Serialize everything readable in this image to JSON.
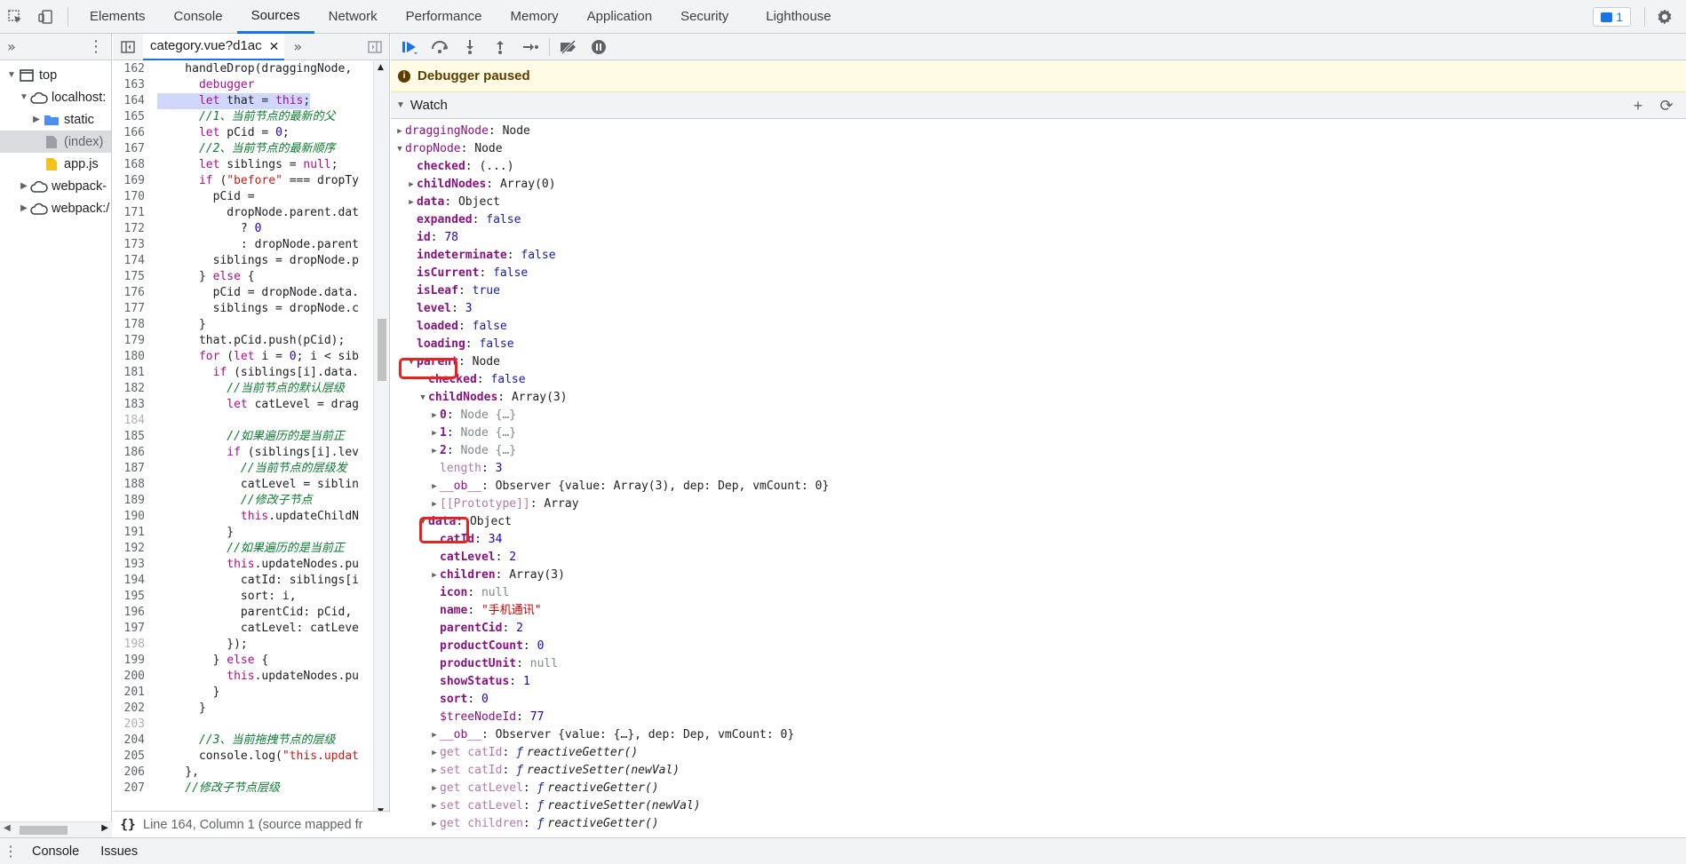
{
  "tabs": [
    "Elements",
    "Console",
    "Sources",
    "Network",
    "Performance",
    "Memory",
    "Application",
    "Security",
    "Lighthouse"
  ],
  "active_tab": "Sources",
  "message_count": "1",
  "navigator": {
    "items": [
      {
        "label": "top",
        "indent": 0,
        "arrow": "down",
        "icon": "frame"
      },
      {
        "label": "localhost:",
        "indent": 1,
        "arrow": "down",
        "icon": "cloud"
      },
      {
        "label": "static",
        "indent": 2,
        "arrow": "right",
        "icon": "folder"
      },
      {
        "label": "(index)",
        "indent": 2,
        "arrow": "",
        "icon": "file-gray",
        "selected": true
      },
      {
        "label": "app.js",
        "indent": 2,
        "arrow": "",
        "icon": "file-yellow"
      },
      {
        "label": "webpack-",
        "indent": 1,
        "arrow": "right",
        "icon": "cloud"
      },
      {
        "label": "webpack:/",
        "indent": 1,
        "arrow": "right",
        "icon": "cloud"
      }
    ]
  },
  "editor": {
    "file_tab": "category.vue?d1ac",
    "status": "Line 164, Column 1  (source mapped fr",
    "lines": [
      {
        "n": "162",
        "parts": [
          [
            "",
            "    handleDrop(draggingNode, "
          ]
        ]
      },
      {
        "n": "163",
        "parts": [
          [
            "kw",
            "      debugger"
          ]
        ]
      },
      {
        "n": "164",
        "hl": true,
        "parts": [
          [
            "kw",
            "      let "
          ],
          [
            "",
            "that = "
          ],
          [
            "kw",
            "this"
          ],
          [
            "",
            ";"
          ]
        ]
      },
      {
        "n": "165",
        "parts": [
          [
            "cm",
            "      //1、当前节点的最新的父"
          ]
        ]
      },
      {
        "n": "166",
        "parts": [
          [
            "kw",
            "      let "
          ],
          [
            "",
            "pCid = "
          ],
          [
            "nm",
            "0"
          ],
          [
            "",
            ";"
          ]
        ]
      },
      {
        "n": "167",
        "parts": [
          [
            "cm",
            "      //2、当前节点的最新顺序"
          ]
        ]
      },
      {
        "n": "168",
        "parts": [
          [
            "kw",
            "      let "
          ],
          [
            "",
            "siblings = "
          ],
          [
            "kw",
            "null"
          ],
          [
            "",
            ";"
          ]
        ]
      },
      {
        "n": "169",
        "parts": [
          [
            "kw",
            "      if "
          ],
          [
            "",
            "("
          ],
          [
            "st",
            "\"before\""
          ],
          [
            "",
            " === dropTy"
          ]
        ]
      },
      {
        "n": "170",
        "parts": [
          [
            "",
            "        pCid ="
          ]
        ]
      },
      {
        "n": "171",
        "parts": [
          [
            "",
            "          dropNode.parent.dat"
          ]
        ]
      },
      {
        "n": "172",
        "parts": [
          [
            "",
            "            ? "
          ],
          [
            "nm",
            "0"
          ]
        ]
      },
      {
        "n": "173",
        "parts": [
          [
            "",
            "            : dropNode.parent"
          ]
        ]
      },
      {
        "n": "174",
        "parts": [
          [
            "",
            "        siblings = dropNode.p"
          ]
        ]
      },
      {
        "n": "175",
        "parts": [
          [
            "",
            "      } "
          ],
          [
            "kw",
            "else"
          ],
          [
            "",
            " {"
          ]
        ]
      },
      {
        "n": "176",
        "parts": [
          [
            "",
            "        pCid = dropNode.data."
          ]
        ]
      },
      {
        "n": "177",
        "parts": [
          [
            "",
            "        siblings = dropNode.c"
          ]
        ]
      },
      {
        "n": "178",
        "parts": [
          [
            "",
            "      }"
          ]
        ]
      },
      {
        "n": "179",
        "parts": [
          [
            "",
            "      that.pCid.push(pCid);"
          ]
        ]
      },
      {
        "n": "180",
        "parts": [
          [
            "kw",
            "      for "
          ],
          [
            "",
            "("
          ],
          [
            "kw",
            "let "
          ],
          [
            "",
            "i = "
          ],
          [
            "nm",
            "0"
          ],
          [
            "",
            "; i < sib"
          ]
        ]
      },
      {
        "n": "181",
        "parts": [
          [
            "kw",
            "        if "
          ],
          [
            "",
            "(siblings[i].data."
          ]
        ]
      },
      {
        "n": "182",
        "parts": [
          [
            "cm",
            "          //当前节点的默认层级"
          ]
        ]
      },
      {
        "n": "183",
        "parts": [
          [
            "kw",
            "          let "
          ],
          [
            "",
            "catLevel = drag"
          ]
        ]
      },
      {
        "n": "184",
        "dim": true,
        "parts": [
          [
            "",
            ""
          ]
        ]
      },
      {
        "n": "185",
        "parts": [
          [
            "cm",
            "          //如果遍历的是当前正"
          ]
        ]
      },
      {
        "n": "186",
        "parts": [
          [
            "kw",
            "          if "
          ],
          [
            "",
            "(siblings[i].lev"
          ]
        ]
      },
      {
        "n": "187",
        "parts": [
          [
            "cm",
            "            //当前节点的层级发"
          ]
        ]
      },
      {
        "n": "188",
        "parts": [
          [
            "",
            "            catLevel = siblin"
          ]
        ]
      },
      {
        "n": "189",
        "parts": [
          [
            "cm",
            "            //修改子节点"
          ]
        ]
      },
      {
        "n": "190",
        "parts": [
          [
            "kw",
            "            this"
          ],
          [
            "",
            ".updateChildN"
          ]
        ]
      },
      {
        "n": "191",
        "parts": [
          [
            "",
            "          }"
          ]
        ]
      },
      {
        "n": "192",
        "parts": [
          [
            "cm",
            "          //如果遍历的是当前正"
          ]
        ]
      },
      {
        "n": "193",
        "parts": [
          [
            "kw",
            "          this"
          ],
          [
            "",
            ".updateNodes.pu"
          ]
        ]
      },
      {
        "n": "194",
        "parts": [
          [
            "",
            "            catId: siblings[i"
          ]
        ]
      },
      {
        "n": "195",
        "parts": [
          [
            "",
            "            sort: i,"
          ]
        ]
      },
      {
        "n": "196",
        "parts": [
          [
            "",
            "            parentCid: pCid,"
          ]
        ]
      },
      {
        "n": "197",
        "parts": [
          [
            "",
            "            catLevel: catLeve"
          ]
        ]
      },
      {
        "n": "198",
        "dim": true,
        "parts": [
          [
            "",
            "          });"
          ]
        ]
      },
      {
        "n": "199",
        "parts": [
          [
            "",
            "        } "
          ],
          [
            "kw",
            "else"
          ],
          [
            "",
            " {"
          ]
        ]
      },
      {
        "n": "200",
        "parts": [
          [
            "kw",
            "          this"
          ],
          [
            "",
            ".updateNodes.pu"
          ]
        ]
      },
      {
        "n": "201",
        "parts": [
          [
            "",
            "        }"
          ]
        ]
      },
      {
        "n": "202",
        "parts": [
          [
            "",
            "      }"
          ]
        ]
      },
      {
        "n": "203",
        "dim": true,
        "parts": [
          [
            "",
            ""
          ]
        ]
      },
      {
        "n": "204",
        "parts": [
          [
            "cm",
            "      //3、当前拖拽节点的层级"
          ]
        ]
      },
      {
        "n": "205",
        "parts": [
          [
            "",
            "      console.log("
          ],
          [
            "st",
            "\"this.updat"
          ]
        ]
      },
      {
        "n": "206",
        "parts": [
          [
            "",
            "    },"
          ]
        ]
      },
      {
        "n": "207",
        "parts": [
          [
            "cm",
            "    //修改子节点层级"
          ]
        ]
      }
    ]
  },
  "debugger": {
    "paused_text": "Debugger paused",
    "watch_title": "Watch",
    "rows": [
      {
        "indent": 0,
        "arrow": "right",
        "key": "draggingNode",
        "style": "k",
        "val": "Node",
        "vtype": ""
      },
      {
        "indent": 0,
        "arrow": "down",
        "key": "dropNode",
        "style": "k",
        "val": "Node",
        "vtype": ""
      },
      {
        "indent": 1,
        "arrow": "",
        "key": "checked",
        "style": "kb",
        "val": "(...)",
        "vtype": ""
      },
      {
        "indent": 1,
        "arrow": "right",
        "key": "childNodes",
        "style": "kb",
        "val": "Array(0)",
        "vtype": ""
      },
      {
        "indent": 1,
        "arrow": "right",
        "key": "data",
        "style": "kb",
        "val": "Object",
        "vtype": ""
      },
      {
        "indent": 1,
        "arrow": "",
        "key": "expanded",
        "style": "kb",
        "val": "false",
        "vtype": "kw"
      },
      {
        "indent": 1,
        "arrow": "",
        "key": "id",
        "style": "kb",
        "val": "78",
        "vtype": "num"
      },
      {
        "indent": 1,
        "arrow": "",
        "key": "indeterminate",
        "style": "kb",
        "val": "false",
        "vtype": "kw"
      },
      {
        "indent": 1,
        "arrow": "",
        "key": "isCurrent",
        "style": "kb",
        "val": "false",
        "vtype": "kw"
      },
      {
        "indent": 1,
        "arrow": "",
        "key": "isLeaf",
        "style": "kb",
        "val": "true",
        "vtype": "kw"
      },
      {
        "indent": 1,
        "arrow": "",
        "key": "level",
        "style": "kb",
        "val": "3",
        "vtype": "num"
      },
      {
        "indent": 1,
        "arrow": "",
        "key": "loaded",
        "style": "kb",
        "val": "false",
        "vtype": "kw"
      },
      {
        "indent": 1,
        "arrow": "",
        "key": "loading",
        "style": "kb",
        "val": "false",
        "vtype": "kw"
      },
      {
        "indent": 1,
        "arrow": "down",
        "key": "parent",
        "style": "kb",
        "val": "Node",
        "vtype": ""
      },
      {
        "indent": 2,
        "arrow": "",
        "key": "checked",
        "style": "kb",
        "val": "false",
        "vtype": "kw"
      },
      {
        "indent": 2,
        "arrow": "down",
        "key": "childNodes",
        "style": "kb",
        "val": "Array(3)",
        "vtype": ""
      },
      {
        "indent": 3,
        "arrow": "right",
        "key": "0",
        "style": "kb",
        "val": "Node {…}",
        "vtype": "nul"
      },
      {
        "indent": 3,
        "arrow": "right",
        "key": "1",
        "style": "kb",
        "val": "Node {…}",
        "vtype": "nul"
      },
      {
        "indent": 3,
        "arrow": "right",
        "key": "2",
        "style": "kb",
        "val": "Node {…}",
        "vtype": "nul"
      },
      {
        "indent": 3,
        "arrow": "",
        "key": "length",
        "style": "kd",
        "val": "3",
        "vtype": "num"
      },
      {
        "indent": 3,
        "arrow": "right",
        "key": "__ob__",
        "style": "k",
        "val": "Observer {value: Array(3), dep: Dep, vmCount: 0}",
        "vtype": ""
      },
      {
        "indent": 3,
        "arrow": "right",
        "key": "[[Prototype]]",
        "style": "kd",
        "val": "Array",
        "vtype": ""
      },
      {
        "indent": 2,
        "arrow": "down",
        "key": "data",
        "style": "kb",
        "val": "Object",
        "vtype": ""
      },
      {
        "indent": 3,
        "arrow": "",
        "key": "catId",
        "style": "kb",
        "val": "34",
        "vtype": "num"
      },
      {
        "indent": 3,
        "arrow": "",
        "key": "catLevel",
        "style": "kb",
        "val": "2",
        "vtype": "num"
      },
      {
        "indent": 3,
        "arrow": "right",
        "key": "children",
        "style": "kb",
        "val": "Array(3)",
        "vtype": ""
      },
      {
        "indent": 3,
        "arrow": "",
        "key": "icon",
        "style": "kb",
        "val": "null",
        "vtype": "nul"
      },
      {
        "indent": 3,
        "arrow": "",
        "key": "name",
        "style": "kb",
        "val": "\"手机通讯\"",
        "vtype": "str"
      },
      {
        "indent": 3,
        "arrow": "",
        "key": "parentCid",
        "style": "kb",
        "val": "2",
        "vtype": "num"
      },
      {
        "indent": 3,
        "arrow": "",
        "key": "productCount",
        "style": "kb",
        "val": "0",
        "vtype": "num"
      },
      {
        "indent": 3,
        "arrow": "",
        "key": "productUnit",
        "style": "kb",
        "val": "null",
        "vtype": "nul"
      },
      {
        "indent": 3,
        "arrow": "",
        "key": "showStatus",
        "style": "kb",
        "val": "1",
        "vtype": "num"
      },
      {
        "indent": 3,
        "arrow": "",
        "key": "sort",
        "style": "kb",
        "val": "0",
        "vtype": "num"
      },
      {
        "indent": 3,
        "arrow": "",
        "key": "$treeNodeId",
        "style": "k",
        "val": "77",
        "vtype": "num"
      },
      {
        "indent": 3,
        "arrow": "right",
        "key": "__ob__",
        "style": "k",
        "val": "Observer {value: {…}, dep: Dep, vmCount: 0}",
        "vtype": ""
      },
      {
        "indent": 3,
        "arrow": "right",
        "key": "get catId",
        "style": "kd",
        "val": "reactiveGetter()",
        "vtype": "fn"
      },
      {
        "indent": 3,
        "arrow": "right",
        "key": "set catId",
        "style": "kd",
        "val": "reactiveSetter(newVal)",
        "vtype": "fn"
      },
      {
        "indent": 3,
        "arrow": "right",
        "key": "get catLevel",
        "style": "kd",
        "val": "reactiveGetter()",
        "vtype": "fn"
      },
      {
        "indent": 3,
        "arrow": "right",
        "key": "set catLevel",
        "style": "kd",
        "val": "reactiveSetter(newVal)",
        "vtype": "fn"
      },
      {
        "indent": 3,
        "arrow": "right",
        "key": "get children",
        "style": "kd",
        "val": "reactiveGetter()",
        "vtype": "fn"
      }
    ]
  },
  "drawer": {
    "tabs": [
      "Console",
      "Issues"
    ]
  },
  "colors": {
    "accent": "#1a73e8",
    "highlight": "#e8231f",
    "paused_bg": "#fffbe5"
  }
}
